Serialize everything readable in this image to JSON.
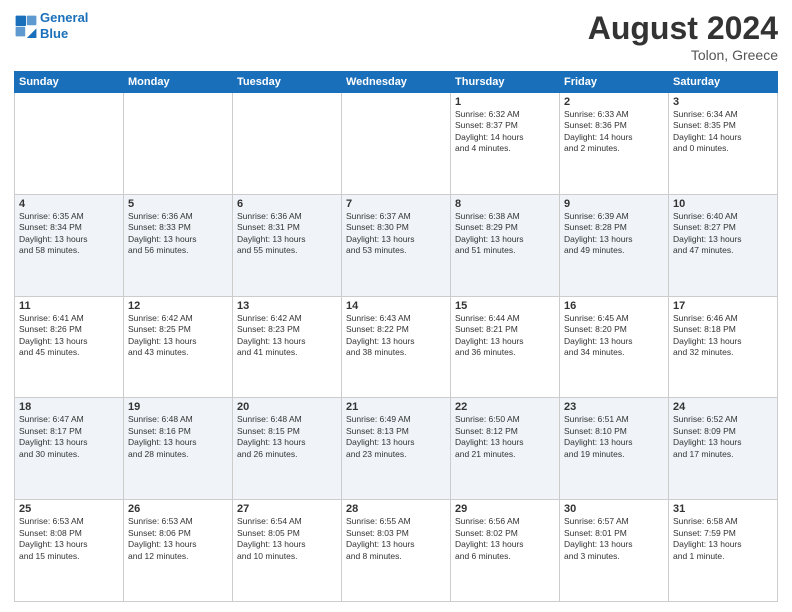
{
  "header": {
    "logo_line1": "General",
    "logo_line2": "Blue",
    "month_year": "August 2024",
    "location": "Tolon, Greece"
  },
  "days_of_week": [
    "Sunday",
    "Monday",
    "Tuesday",
    "Wednesday",
    "Thursday",
    "Friday",
    "Saturday"
  ],
  "weeks": [
    [
      {
        "num": "",
        "info": ""
      },
      {
        "num": "",
        "info": ""
      },
      {
        "num": "",
        "info": ""
      },
      {
        "num": "",
        "info": ""
      },
      {
        "num": "1",
        "info": "Sunrise: 6:32 AM\nSunset: 8:37 PM\nDaylight: 14 hours\nand 4 minutes."
      },
      {
        "num": "2",
        "info": "Sunrise: 6:33 AM\nSunset: 8:36 PM\nDaylight: 14 hours\nand 2 minutes."
      },
      {
        "num": "3",
        "info": "Sunrise: 6:34 AM\nSunset: 8:35 PM\nDaylight: 14 hours\nand 0 minutes."
      }
    ],
    [
      {
        "num": "4",
        "info": "Sunrise: 6:35 AM\nSunset: 8:34 PM\nDaylight: 13 hours\nand 58 minutes."
      },
      {
        "num": "5",
        "info": "Sunrise: 6:36 AM\nSunset: 8:33 PM\nDaylight: 13 hours\nand 56 minutes."
      },
      {
        "num": "6",
        "info": "Sunrise: 6:36 AM\nSunset: 8:31 PM\nDaylight: 13 hours\nand 55 minutes."
      },
      {
        "num": "7",
        "info": "Sunrise: 6:37 AM\nSunset: 8:30 PM\nDaylight: 13 hours\nand 53 minutes."
      },
      {
        "num": "8",
        "info": "Sunrise: 6:38 AM\nSunset: 8:29 PM\nDaylight: 13 hours\nand 51 minutes."
      },
      {
        "num": "9",
        "info": "Sunrise: 6:39 AM\nSunset: 8:28 PM\nDaylight: 13 hours\nand 49 minutes."
      },
      {
        "num": "10",
        "info": "Sunrise: 6:40 AM\nSunset: 8:27 PM\nDaylight: 13 hours\nand 47 minutes."
      }
    ],
    [
      {
        "num": "11",
        "info": "Sunrise: 6:41 AM\nSunset: 8:26 PM\nDaylight: 13 hours\nand 45 minutes."
      },
      {
        "num": "12",
        "info": "Sunrise: 6:42 AM\nSunset: 8:25 PM\nDaylight: 13 hours\nand 43 minutes."
      },
      {
        "num": "13",
        "info": "Sunrise: 6:42 AM\nSunset: 8:23 PM\nDaylight: 13 hours\nand 41 minutes."
      },
      {
        "num": "14",
        "info": "Sunrise: 6:43 AM\nSunset: 8:22 PM\nDaylight: 13 hours\nand 38 minutes."
      },
      {
        "num": "15",
        "info": "Sunrise: 6:44 AM\nSunset: 8:21 PM\nDaylight: 13 hours\nand 36 minutes."
      },
      {
        "num": "16",
        "info": "Sunrise: 6:45 AM\nSunset: 8:20 PM\nDaylight: 13 hours\nand 34 minutes."
      },
      {
        "num": "17",
        "info": "Sunrise: 6:46 AM\nSunset: 8:18 PM\nDaylight: 13 hours\nand 32 minutes."
      }
    ],
    [
      {
        "num": "18",
        "info": "Sunrise: 6:47 AM\nSunset: 8:17 PM\nDaylight: 13 hours\nand 30 minutes."
      },
      {
        "num": "19",
        "info": "Sunrise: 6:48 AM\nSunset: 8:16 PM\nDaylight: 13 hours\nand 28 minutes."
      },
      {
        "num": "20",
        "info": "Sunrise: 6:48 AM\nSunset: 8:15 PM\nDaylight: 13 hours\nand 26 minutes."
      },
      {
        "num": "21",
        "info": "Sunrise: 6:49 AM\nSunset: 8:13 PM\nDaylight: 13 hours\nand 23 minutes."
      },
      {
        "num": "22",
        "info": "Sunrise: 6:50 AM\nSunset: 8:12 PM\nDaylight: 13 hours\nand 21 minutes."
      },
      {
        "num": "23",
        "info": "Sunrise: 6:51 AM\nSunset: 8:10 PM\nDaylight: 13 hours\nand 19 minutes."
      },
      {
        "num": "24",
        "info": "Sunrise: 6:52 AM\nSunset: 8:09 PM\nDaylight: 13 hours\nand 17 minutes."
      }
    ],
    [
      {
        "num": "25",
        "info": "Sunrise: 6:53 AM\nSunset: 8:08 PM\nDaylight: 13 hours\nand 15 minutes."
      },
      {
        "num": "26",
        "info": "Sunrise: 6:53 AM\nSunset: 8:06 PM\nDaylight: 13 hours\nand 12 minutes."
      },
      {
        "num": "27",
        "info": "Sunrise: 6:54 AM\nSunset: 8:05 PM\nDaylight: 13 hours\nand 10 minutes."
      },
      {
        "num": "28",
        "info": "Sunrise: 6:55 AM\nSunset: 8:03 PM\nDaylight: 13 hours\nand 8 minutes."
      },
      {
        "num": "29",
        "info": "Sunrise: 6:56 AM\nSunset: 8:02 PM\nDaylight: 13 hours\nand 6 minutes."
      },
      {
        "num": "30",
        "info": "Sunrise: 6:57 AM\nSunset: 8:01 PM\nDaylight: 13 hours\nand 3 minutes."
      },
      {
        "num": "31",
        "info": "Sunrise: 6:58 AM\nSunset: 7:59 PM\nDaylight: 13 hours\nand 1 minute."
      }
    ]
  ]
}
